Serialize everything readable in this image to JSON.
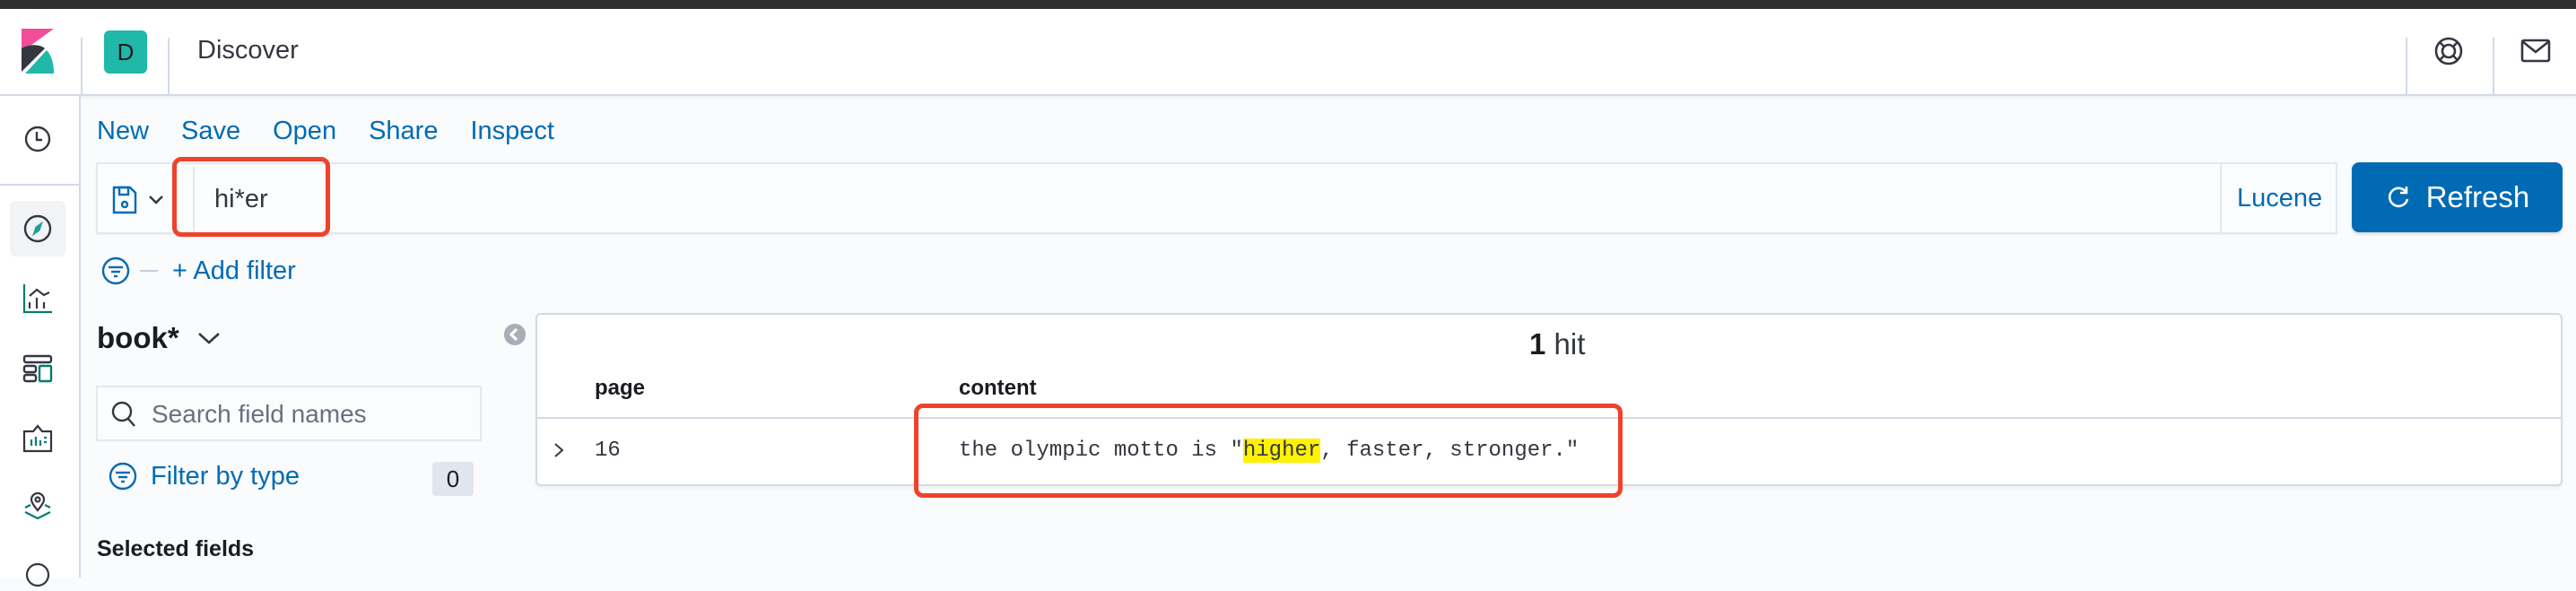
{
  "header": {
    "app_title": "Discover",
    "space_avatar_letter": "D",
    "icons": [
      "kibana-logo",
      "help-icon",
      "mail-icon"
    ]
  },
  "nav": {
    "items": [
      "recently-viewed",
      "discover",
      "visualize",
      "dashboard",
      "canvas",
      "maps"
    ],
    "active": "discover"
  },
  "menu": {
    "new": "New",
    "save": "Save",
    "open": "Open",
    "share": "Share",
    "inspect": "Inspect"
  },
  "query": {
    "value": "hi*er",
    "language": "Lucene",
    "refresh_label": "Refresh"
  },
  "filters": {
    "add_filter_label": "+ Add filter"
  },
  "sidebar": {
    "index_pattern": "book*",
    "search_placeholder": "Search field names",
    "filter_by_type_label": "Filter by type",
    "filter_count": "0",
    "selected_fields_label": "Selected fields"
  },
  "results": {
    "hit_count": "1",
    "hit_label": "hit",
    "columns": [
      "page",
      "content"
    ],
    "rows": [
      {
        "page": "16",
        "content_before": "the olympic motto is \"",
        "content_highlight": "higher",
        "content_after": ", faster, stronger.\""
      }
    ]
  },
  "colors": {
    "accent": "#006bb4",
    "highlight": "#fff200",
    "annotation": "#f0422a",
    "avatar": "#20b8a9"
  }
}
